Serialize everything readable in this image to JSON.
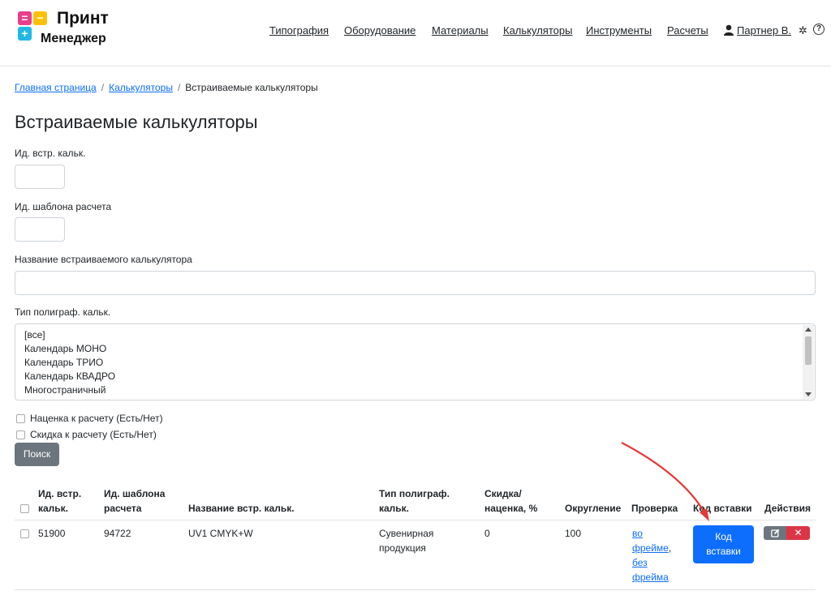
{
  "header": {
    "logo_line1": "Принт",
    "logo_line2": "Менеджер",
    "nav": [
      "Типография",
      "Оборудование",
      "Материалы",
      "Калькуляторы",
      "Инструменты",
      "Расчеты"
    ],
    "user": "Партнер В.",
    "help": "?"
  },
  "breadcrumb": {
    "home": "Главная страница",
    "calcs": "Калькуляторы",
    "current": "Встраиваемые калькуляторы"
  },
  "page_title": "Встраиваемые калькуляторы",
  "filters": {
    "embed_id_label": "Ид. встр. кальк.",
    "template_id_label": "Ид. шаблона расчета",
    "name_label": "Название встраиваемого калькулятора",
    "type_label": "Тип полиграф. кальк.",
    "type_options": [
      "[все]",
      "Календарь МОНО",
      "Календарь ТРИО",
      "Календарь КВАДРО",
      "Многостраничный"
    ],
    "markup_label": "Наценка к расчету (Есть/Нет)",
    "discount_label": "Скидка к расчету (Есть/Нет)",
    "search_button": "Поиск"
  },
  "table": {
    "headers": {
      "id": [
        "Ид. встр.",
        "кальк."
      ],
      "template": [
        "Ид. шаблона",
        "расчета"
      ],
      "name": "Название встр. кальк.",
      "type": [
        "Тип полиграф.",
        "кальк."
      ],
      "discount": [
        "Скидка/",
        "наценка, %"
      ],
      "rounding": "Округление",
      "check": "Проверка",
      "code": "Код вставки",
      "actions": "Действия"
    },
    "rows": [
      {
        "id": "51900",
        "template": "94722",
        "name": "UV1 CMYK+W",
        "type": [
          "Сувенирная",
          "продукция"
        ],
        "discount": "0",
        "rounding": "100",
        "check_in_frame": [
          "во",
          "фрейме"
        ],
        "check_comma": ",",
        "check_no_frame": [
          "без",
          "фрейма"
        ],
        "code_button": [
          "Код",
          "вставки"
        ],
        "delete": "✕"
      }
    ]
  },
  "colors": {
    "primary": "#0d6efd",
    "secondary": "#6c757d",
    "danger": "#dc3545",
    "arrow": "#e53935"
  }
}
